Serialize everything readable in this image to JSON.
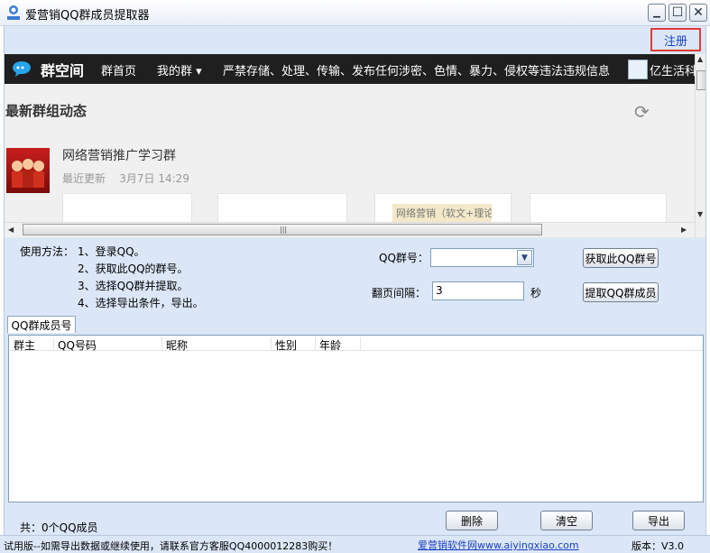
{
  "window": {
    "title": "爱营销QQ群成员提取器",
    "controls": {
      "minimize": "▁",
      "maximize": "☐",
      "close": "✕"
    }
  },
  "register_link": "注册",
  "webview": {
    "logo_text": "群空间",
    "nav": [
      "群首页",
      "我的群 ▾"
    ],
    "notice": "严禁存储、处理、传输、发布任何涉密、色情、暴力、侵权等违法违规信息",
    "partner_text": "亿生活科",
    "section_title": "最新群组动态",
    "group_name": "网络营销推广学习群",
    "group_meta_label": "最近更新",
    "group_meta_time": "3月7日 14:29",
    "card_text": "网络营销（软文+理论"
  },
  "instructions": {
    "heading": "使用方法：",
    "steps": [
      "1、登录QQ。",
      "2、获取此QQ的群号。",
      "3、选择QQ群并提取。",
      "4、选择导出条件，导出。"
    ]
  },
  "form": {
    "group_label": "QQ群号：",
    "group_value": "",
    "interval_label": "翻页间隔：",
    "interval_value": "3",
    "interval_unit": "秒",
    "get_group_button": "获取此QQ群号",
    "extract_button": "提取QQ群成员"
  },
  "members_tab": "QQ群成员号",
  "table": {
    "columns": [
      "群主",
      "QQ号码",
      "昵称",
      "性别",
      "年龄"
    ],
    "rows": []
  },
  "summary": "共：0个QQ成员",
  "buttons": {
    "delete": "删除",
    "clear": "清空",
    "export": "导出"
  },
  "status": {
    "trial_notice": "试用版--如需导出数据或继续使用，请联系官方客服QQ4000012283购买！",
    "software_link_label": "爱营销软件网",
    "software_link_url": "www.aiyingxiao.com",
    "version": "版本：V3.0"
  },
  "colors": {
    "panel_bg": "#dbe7f7",
    "nav_bg": "#1f1f1f",
    "register_border": "#e23a3a",
    "link": "#1a3fbf"
  }
}
